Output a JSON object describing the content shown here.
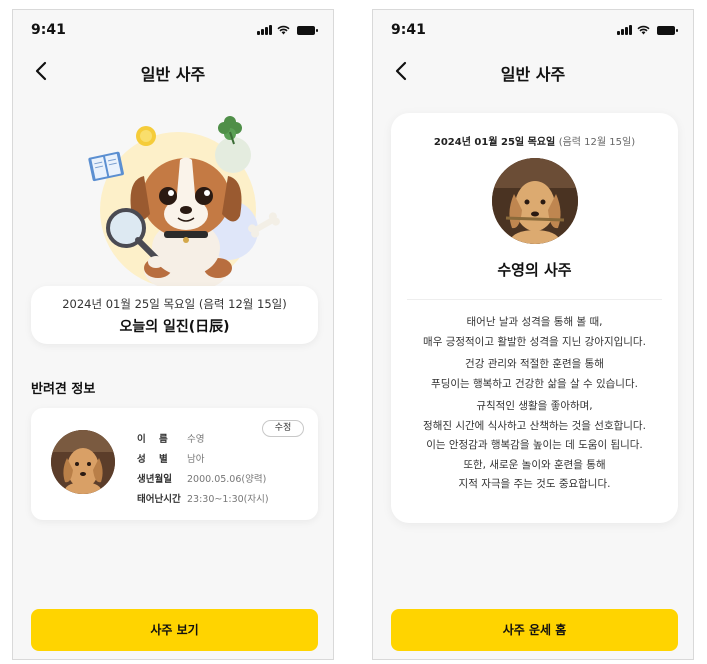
{
  "status_bar": {
    "time": "9:41"
  },
  "left_screen": {
    "title": "일반 사주",
    "date_line": "2024년 01월 25일 목요일 (음력 12월 15일)",
    "iljin_title": "오늘의 일진(日辰)",
    "section_title": "반려견 정보",
    "edit_label": "수정",
    "pet_info": [
      {
        "label": "이    름",
        "value": "수영"
      },
      {
        "label": "성    별",
        "value": "남아"
      },
      {
        "label": "생년월일",
        "value": "2000.05.06(양력)"
      },
      {
        "label": "태어난시간",
        "value": "23:30~1:30(자시)"
      }
    ],
    "cta_label": "사주 보기"
  },
  "right_screen": {
    "title": "일반 사주",
    "date_solar": "2024년 01월 25일 목요일",
    "date_lunar": "(음력 12월 15일)",
    "name_title": "수영의 사주",
    "paragraphs": [
      [
        "태어난 날과 성격을 통해 볼 때,",
        "매우 긍정적이고 활발한 성격을 지닌 강아지입니다."
      ],
      [
        "건강 관리와 적절한 훈련을 통해",
        "푸딩이는 행복하고 건강한 삶을 살 수 있습니다."
      ],
      [
        "규칙적인 생활을 좋아하며,",
        "정해진 시간에 식사하고 산책하는 것을 선호합니다.",
        "이는 안정감과 행복감을 높이는 데 도움이 됩니다.",
        "또한, 새로운 놀이와 훈련을 통해",
        "지적 자극을 주는 것도 중요합니다."
      ]
    ],
    "cta_label": "사주 운세 홈"
  },
  "colors": {
    "accent": "#ffd400",
    "background": "#f7f7f7",
    "card": "#ffffff"
  }
}
